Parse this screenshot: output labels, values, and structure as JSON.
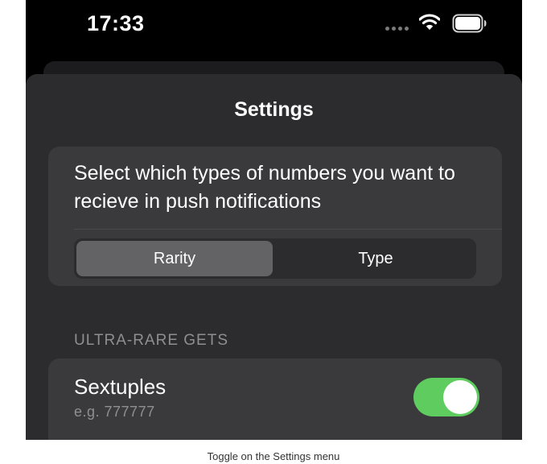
{
  "status_bar": {
    "time": "17:33",
    "icons": [
      "signal-dots-icon",
      "wifi-icon",
      "battery-icon"
    ]
  },
  "settings": {
    "title": "Settings",
    "description": "Select which types of numbers you want to recieve in push notifications",
    "segments": [
      {
        "label": "Rarity",
        "selected": true
      },
      {
        "label": "Type",
        "selected": false
      }
    ],
    "section_header": "ULTRA-RARE GETS",
    "rows": [
      {
        "title": "Sextuples",
        "subtitle": "e.g. 777777",
        "enabled": true
      }
    ]
  },
  "caption": "Toggle on the Settings menu",
  "colors": {
    "toggle_on": "#5fcc5f",
    "sheet_bg": "#2c2c2e",
    "card_bg": "#3a3a3c",
    "selected_segment": "#636366"
  }
}
